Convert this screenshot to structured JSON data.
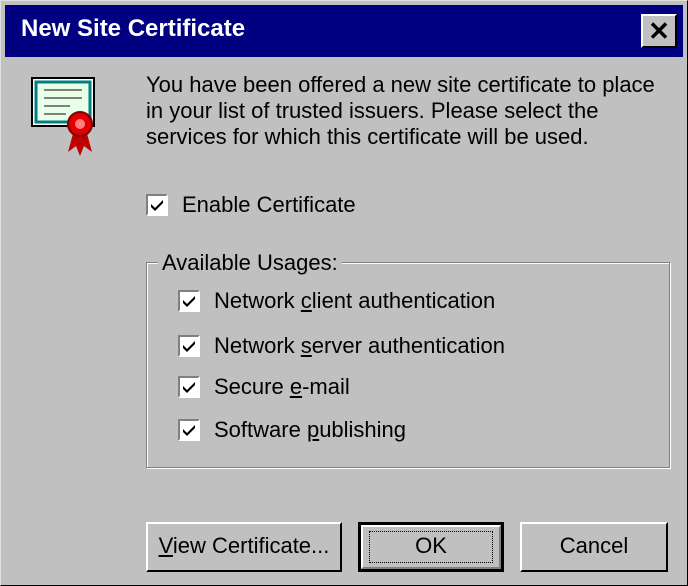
{
  "window": {
    "title": "New Site Certificate"
  },
  "message": "You have been offered a new site certificate to place in your list of trusted issuers. Please select the services for which this certificate will be used.",
  "enable": {
    "label": "Enable Certificate",
    "checked": true
  },
  "usages": {
    "legend": "Available Usages:",
    "items": [
      {
        "pre": "Network ",
        "ul": "c",
        "post": "lient authentication",
        "checked": true
      },
      {
        "pre": "Network ",
        "ul": "s",
        "post": "erver authentication",
        "checked": true
      },
      {
        "pre": "Secure ",
        "ul": "e",
        "post": "-mail",
        "checked": true
      },
      {
        "pre": "Software ",
        "ul": "p",
        "post": "ublishing",
        "checked": true
      }
    ]
  },
  "buttons": {
    "view": {
      "ul": "V",
      "rest": "iew Certificate..."
    },
    "ok": {
      "label": "OK"
    },
    "cancel": {
      "label": "Cancel"
    }
  },
  "icons": [
    "certificate-icon",
    "close-icon",
    "checkmark-icon"
  ]
}
